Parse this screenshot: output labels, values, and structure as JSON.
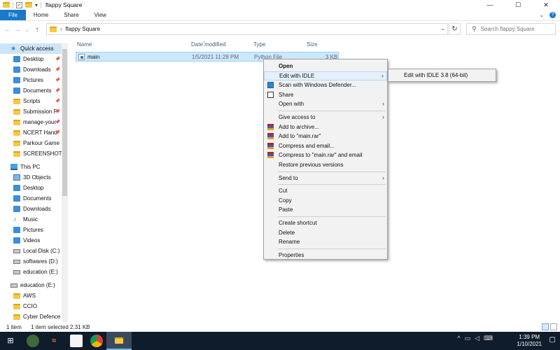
{
  "window": {
    "title": "flappy Square",
    "controls": {
      "minimize": "—",
      "maximize": "☐",
      "close": "✕"
    }
  },
  "ribbon": {
    "tabs": [
      {
        "label": "File",
        "active": true
      },
      {
        "label": "Home"
      },
      {
        "label": "Share"
      },
      {
        "label": "View"
      }
    ],
    "expand_glyph": "⌄",
    "help_glyph": "?"
  },
  "address": {
    "back_glyph": "←",
    "forward_glyph": "→",
    "recent_glyph": "⌄",
    "up_glyph": "↑",
    "crumb_separator": "›",
    "crumb": "flappy Square",
    "dropdown_glyph": "⌄",
    "refresh_glyph": "↻",
    "search_placeholder": "Search flappy Square"
  },
  "nav": {
    "pin_glyph": "📌",
    "quick_access": {
      "label": "Quick access",
      "items": [
        {
          "label": "Desktop",
          "icon": "blue",
          "pinned": true
        },
        {
          "label": "Downloads",
          "icon": "blue",
          "pinned": true
        },
        {
          "label": "Pictures",
          "icon": "blue",
          "pinned": true
        },
        {
          "label": "Documents",
          "icon": "blue",
          "pinned": true
        },
        {
          "label": "Scripts",
          "icon": "folder",
          "pinned": true
        },
        {
          "label": "Submission P",
          "icon": "folder",
          "pinned": true
        },
        {
          "label": "manage-your",
          "icon": "folder",
          "pinned": true
        },
        {
          "label": "NCERT Hand",
          "icon": "folder",
          "pinned": true
        },
        {
          "label": "Parkour Game",
          "icon": "folder",
          "pinned": false
        },
        {
          "label": "SCREENSHOTS",
          "icon": "folder",
          "pinned": false
        }
      ]
    },
    "this_pc": {
      "label": "This PC",
      "items": [
        {
          "label": "3D Objects",
          "icon": "cube"
        },
        {
          "label": "Desktop",
          "icon": "blue"
        },
        {
          "label": "Documents",
          "icon": "blue"
        },
        {
          "label": "Downloads",
          "icon": "blue"
        },
        {
          "label": "Music",
          "icon": "music"
        },
        {
          "label": "Pictures",
          "icon": "blue"
        },
        {
          "label": "Videos",
          "icon": "blue"
        },
        {
          "label": "Local Disk (C:)",
          "icon": "disk"
        },
        {
          "label": "softwares (D:)",
          "icon": "disk"
        },
        {
          "label": "education (E:)",
          "icon": "disk"
        }
      ]
    },
    "drive_e": {
      "label": "education (E:)",
      "items": [
        {
          "label": "AWS",
          "icon": "folder"
        },
        {
          "label": "CCIO",
          "icon": "folder"
        },
        {
          "label": "Cyber Defence",
          "icon": "folder"
        }
      ]
    }
  },
  "list": {
    "columns": {
      "name": "Name",
      "date": "Date modified",
      "type": "Type",
      "size": "Size"
    },
    "sort_glyph": "^",
    "files": [
      {
        "name": "main",
        "date": "1/5/2021 11:28 PM",
        "type": "Python File",
        "size": "3 KB"
      }
    ]
  },
  "context_menu": {
    "submenu_glyph": "›",
    "items": [
      {
        "label": "Open",
        "bold": true
      },
      {
        "label": "Edit with IDLE",
        "submenu": true,
        "hover": true
      },
      {
        "label": "Scan with Windows Defender...",
        "icon": "defender"
      },
      {
        "label": "Share",
        "icon": "share"
      },
      {
        "label": "Open with",
        "submenu": true
      },
      {
        "sep": true
      },
      {
        "label": "Give access to",
        "submenu": true
      },
      {
        "label": "Add to archive...",
        "icon": "winrar"
      },
      {
        "label": "Add to \"main.rar\"",
        "icon": "winrar"
      },
      {
        "label": "Compress and email...",
        "icon": "winrar"
      },
      {
        "label": "Compress to \"main.rar\" and email",
        "icon": "winrar"
      },
      {
        "label": "Restore previous versions"
      },
      {
        "sep": true
      },
      {
        "label": "Send to",
        "submenu": true
      },
      {
        "sep": true
      },
      {
        "label": "Cut"
      },
      {
        "label": "Copy"
      },
      {
        "label": "Paste"
      },
      {
        "sep": true
      },
      {
        "label": "Create shortcut"
      },
      {
        "label": "Delete"
      },
      {
        "label": "Rename"
      },
      {
        "sep": true
      },
      {
        "label": "Properties"
      }
    ]
  },
  "submenu": {
    "item": "Edit with IDLE 3.8 (64-bit)"
  },
  "status": {
    "count": "1 item",
    "selected": "1 item selected  2.31 KB"
  },
  "taskbar": {
    "tray_icons": {
      "chevron": "^",
      "network": "▭",
      "volume": "◁",
      "language": "⌨"
    },
    "notification_glyph": "▢",
    "time": "1:39 PM",
    "date": "1/10/2021"
  }
}
